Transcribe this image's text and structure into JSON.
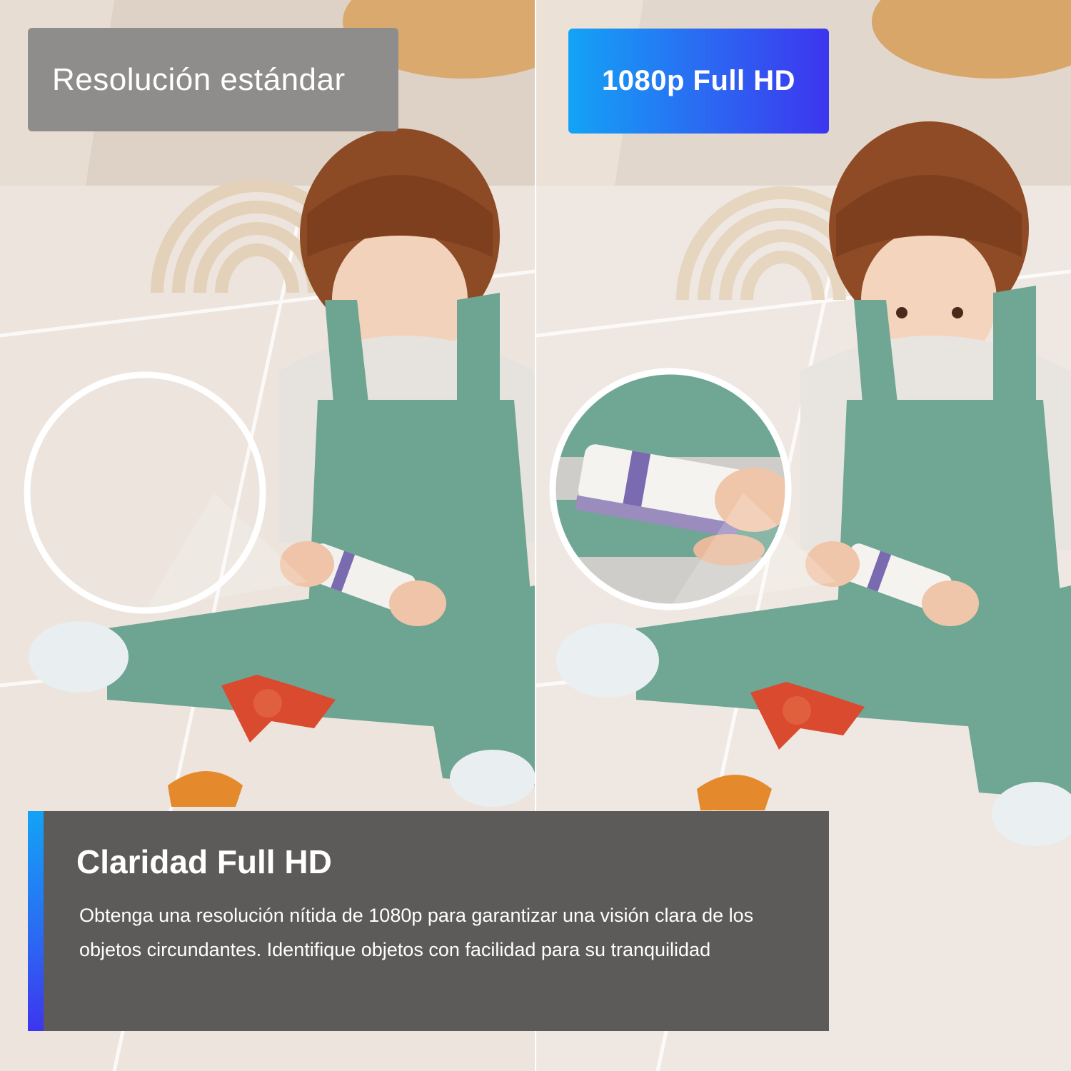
{
  "labels": {
    "standard": "Resolución estándar",
    "full_hd": "1080p Full HD"
  },
  "info": {
    "title": "Claridad Full HD",
    "description": "Obtenga una resolución nítida de 1080p para garantizar una visión clara de los objetos circundantes. Identifique objetos con facilidad para su tranquilidad"
  },
  "colors": {
    "accent_start": "#13a3f6",
    "accent_end": "#3d35ef",
    "overlay": "#585655"
  }
}
